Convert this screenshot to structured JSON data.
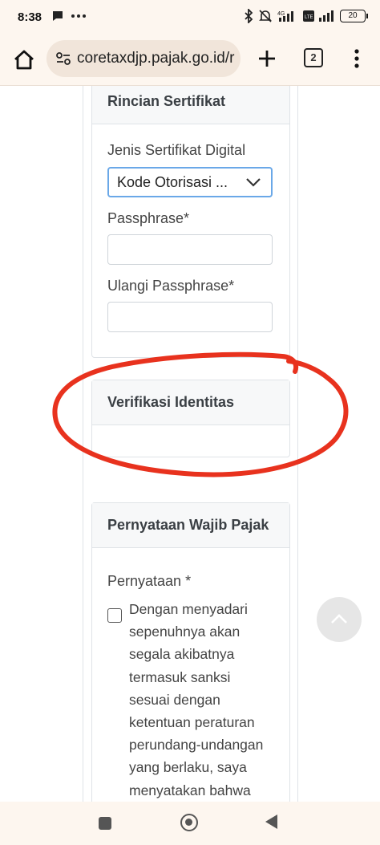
{
  "status_bar": {
    "time": "8:38",
    "battery": "20"
  },
  "browser": {
    "url": "coretaxdjp.pajak.go.id/r",
    "tab_count": "2"
  },
  "rincian_card": {
    "title": "Rincian Sertifikat",
    "jenis_label": "Jenis Sertifikat Digital",
    "jenis_value": "Kode Otorisasi ...",
    "passphrase_label": "Passphrase*",
    "passphrase_value": "",
    "ulangi_label": "Ulangi Passphrase*",
    "ulangi_value": ""
  },
  "verifikasi_card": {
    "title": "Verifikasi Identitas"
  },
  "pernyataan_card": {
    "title": "Pernyataan Wajib Pajak",
    "label": "Pernyataan *",
    "statement_lines": [
      "Dengan menyadari",
      "sepenuhnya akan",
      "segala akibatnya",
      "termasuk sanksi",
      "sesuai dengan",
      "ketentuan peraturan",
      "perundang-undangan",
      "yang berlaku, saya",
      "menyatakan bahwa"
    ],
    "checked": false
  },
  "annotation": {
    "color": "#e8321e",
    "shape": "hand-drawn circle around Verifikasi Identitas"
  },
  "icons": {
    "home": "home-icon",
    "site_info": "site-settings-icon",
    "new_tab": "plus-icon",
    "menu": "kebab-menu-icon",
    "scroll_top": "chevron-up-icon"
  }
}
